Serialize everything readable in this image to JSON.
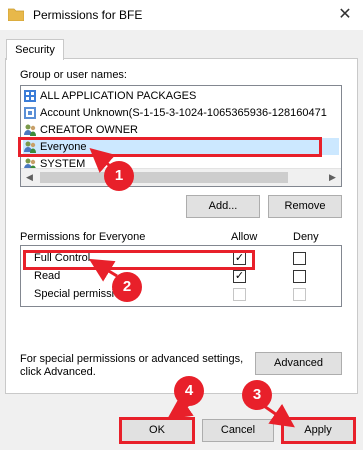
{
  "window": {
    "title": "Permissions for BFE",
    "close_icon": "close-icon"
  },
  "tabs": [
    {
      "label": "Security"
    }
  ],
  "group_label": "Group or user names:",
  "users": [
    {
      "name": "ALL APPLICATION PACKAGES",
      "icon": "package-icon"
    },
    {
      "name": "Account Unknown(S-1-15-3-1024-1065365936-128160471",
      "icon": "unknown-user-icon"
    },
    {
      "name": "CREATOR OWNER",
      "icon": "user-group-icon"
    },
    {
      "name": "Everyone",
      "icon": "user-group-icon"
    },
    {
      "name": "SYSTEM",
      "icon": "user-group-icon"
    }
  ],
  "buttons": {
    "add": "Add...",
    "remove": "Remove",
    "advanced": "Advanced",
    "ok": "OK",
    "cancel": "Cancel",
    "apply": "Apply"
  },
  "permissions": {
    "label": "Permissions for Everyone",
    "allow_header": "Allow",
    "deny_header": "Deny",
    "rows": [
      {
        "name": "Full Control",
        "allow": true,
        "deny": false,
        "disabled": false
      },
      {
        "name": "Read",
        "allow": true,
        "deny": false,
        "disabled": false
      },
      {
        "name": "Special permissions",
        "allow": false,
        "deny": false,
        "disabled": true
      }
    ]
  },
  "special_note": "For special permissions or advanced settings, click Advanced.",
  "annotations": {
    "badge1": "1",
    "badge2": "2",
    "badge3": "3",
    "badge4": "4",
    "accent": "#e8202a"
  }
}
